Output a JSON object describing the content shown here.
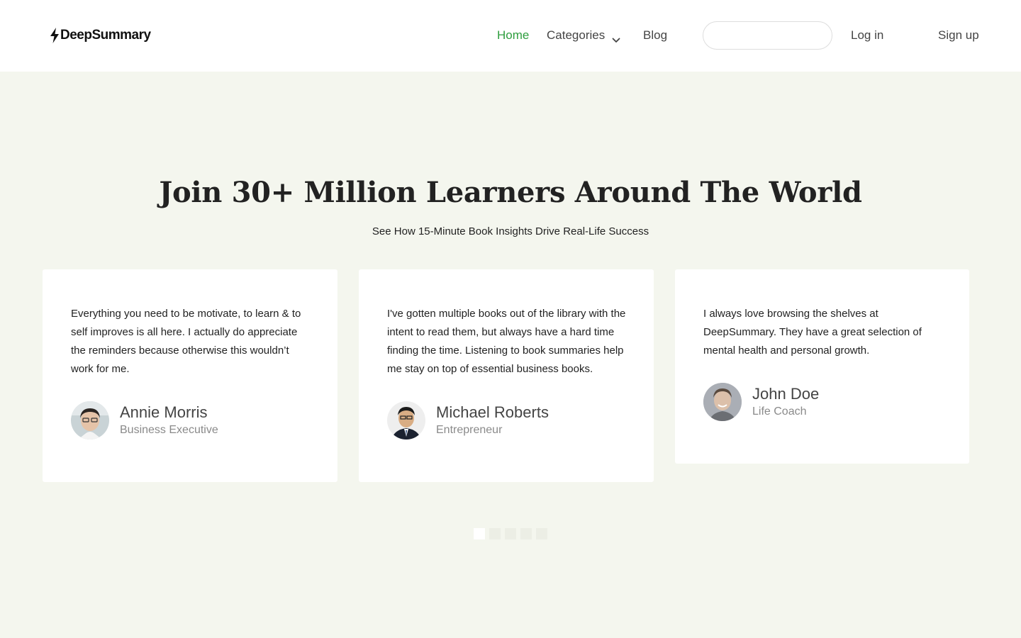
{
  "header": {
    "brand": "DeepSummary",
    "nav": {
      "home": "Home",
      "categories": "Categories",
      "blog": "Blog"
    },
    "search": {
      "placeholder": "",
      "value": ""
    },
    "login": "Log in",
    "signup": "Sign up",
    "colors": {
      "active_nav": "#2e9e3e"
    }
  },
  "hero": {
    "title": "Join 30+ Million Learners Around The World",
    "subtitle": "See How 15-Minute Book Insights Drive Real-Life Success"
  },
  "testimonials": [
    {
      "quote": "Everything you need to be motivate, to learn & to self improves is all here. I actually do appreciate the reminders because otherwise this wouldn’t work for me.",
      "name": "Annie Morris",
      "role": "Business Executive",
      "avatar": "person-avatar"
    },
    {
      "quote": "I've gotten multiple books out of the library with the intent to read them, but always have a hard time finding the time. Listening to book summaries help me stay on top of essential business books.",
      "name": "Michael Roberts",
      "role": "Entrepreneur",
      "avatar": "person-avatar"
    },
    {
      "quote": "I always love browsing the shelves at DeepSummary. They have a great selection of mental health and personal growth.",
      "name": "John Doe",
      "role": "Life Coach",
      "avatar": "person-avatar"
    }
  ],
  "carousel": {
    "pages": 5,
    "active": 1
  }
}
